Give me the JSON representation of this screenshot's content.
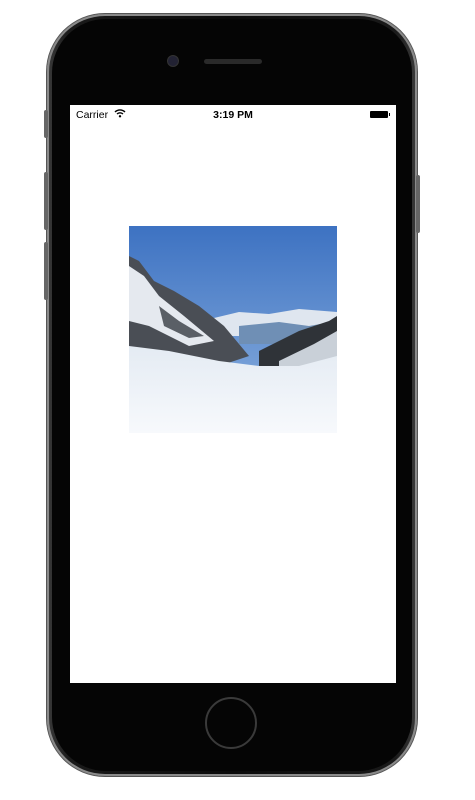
{
  "status_bar": {
    "carrier": "Carrier",
    "time": "3:19 PM",
    "wifi_icon": "wifi-icon",
    "battery_icon": "battery-icon",
    "battery_level": 1.0
  },
  "content": {
    "image": "snowy-mountain-valley-photo"
  }
}
